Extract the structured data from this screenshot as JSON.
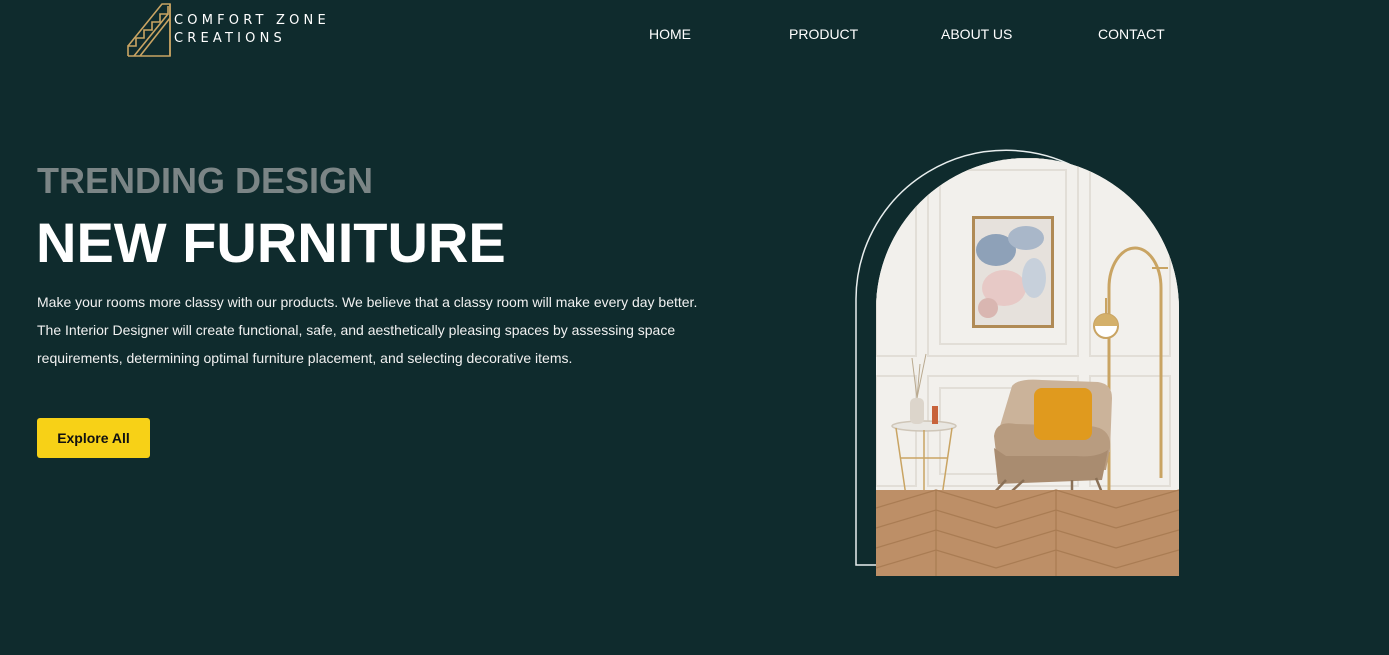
{
  "brand": {
    "name_line1": "COMFORT ZONE",
    "name_line2": "CREATIONS",
    "logo_icon": "staircase-logo-icon",
    "accent_color": "#c9a463"
  },
  "nav": {
    "items": [
      {
        "label": "HOME"
      },
      {
        "label": "PRODUCT"
      },
      {
        "label": "ABOUT US"
      },
      {
        "label": "CONTACT"
      }
    ]
  },
  "hero": {
    "kicker": "TRENDING DESIGN",
    "title": "NEW FURNITURE",
    "description": "Make your rooms more classy with our products. We believe that a classy room will make every day better. The Interior Designer will create functional, safe, and aesthetically pleasing spaces by assessing space requirements, determining optimal furniture placement, and selecting decorative items.",
    "cta_label": "Explore All",
    "image_icon": "armchair-room-image"
  },
  "theme": {
    "background": "#0f2b2d",
    "cta_color": "#f7d117",
    "kicker_color": "#7b8586"
  }
}
